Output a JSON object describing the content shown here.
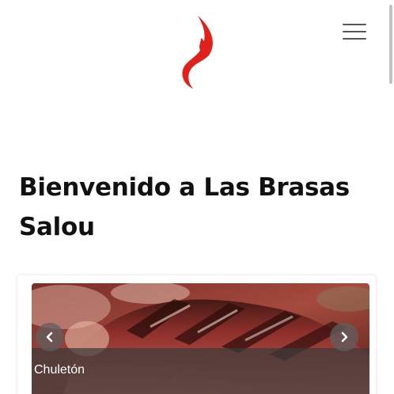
{
  "header": {
    "logo_icon": "flame-icon",
    "menu_icon": "hamburger-menu-icon"
  },
  "welcome": {
    "title_line1": "Bienvenido a Las Brasas",
    "title_line2": "Salou"
  },
  "carousel": {
    "caption": "Chuletón",
    "prev_icon": "chevron-left-icon",
    "next_icon": "chevron-right-icon"
  },
  "colors": {
    "flame": "#e0201b",
    "text": "#111111",
    "caption_bg": "#3c3a3a"
  }
}
